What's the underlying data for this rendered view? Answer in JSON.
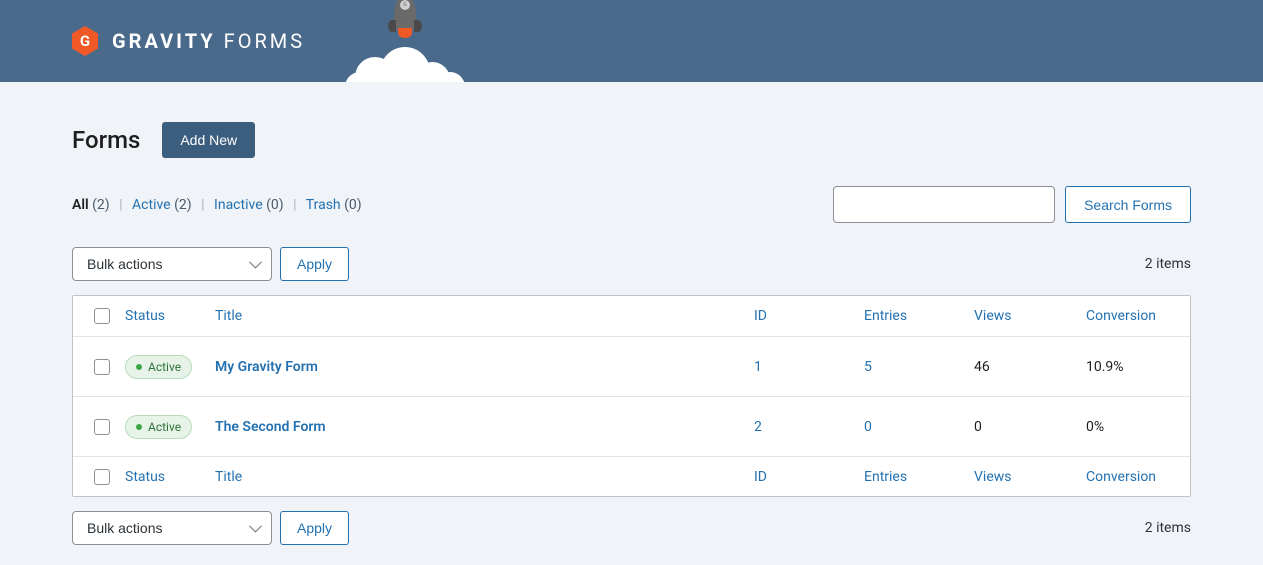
{
  "brand": {
    "logo_letter": "G",
    "name_bold": "GRAVITY",
    "name_light": " FORMS"
  },
  "page": {
    "title": "Forms",
    "add_new_label": "Add New"
  },
  "tabs": [
    {
      "label": "All",
      "count": "(2)",
      "current": true
    },
    {
      "label": "Active",
      "count": "(2)",
      "current": false
    },
    {
      "label": "Inactive",
      "count": "(0)",
      "current": false
    },
    {
      "label": "Trash",
      "count": "(0)",
      "current": false
    }
  ],
  "search": {
    "button_label": "Search Forms",
    "input_value": ""
  },
  "bulk": {
    "select_label": "Bulk actions",
    "apply_label": "Apply"
  },
  "items_count": "2 items",
  "columns": {
    "status": "Status",
    "title": "Title",
    "id": "ID",
    "entries": "Entries",
    "views": "Views",
    "conversion": "Conversion"
  },
  "status_label": "Active",
  "rows": [
    {
      "title": "My Gravity Form",
      "id": "1",
      "entries": "5",
      "views": "46",
      "conversion": "10.9%"
    },
    {
      "title": "The Second Form",
      "id": "2",
      "entries": "0",
      "views": "0",
      "conversion": "0%"
    }
  ]
}
